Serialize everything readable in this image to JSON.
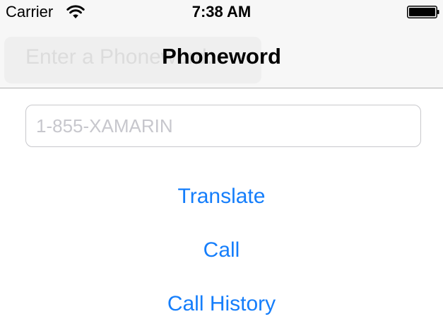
{
  "status_bar": {
    "carrier": "Carrier",
    "time": "7:38 AM",
    "icons": [
      "wifi-icon",
      "battery-icon"
    ]
  },
  "nav_bar": {
    "title": "Phoneword",
    "ghost_text": "Enter a Phoneword:"
  },
  "form": {
    "phone_placeholder": "1-855-XAMARIN",
    "phone_value": ""
  },
  "buttons": {
    "translate": "Translate",
    "call": "Call",
    "call_history": "Call History"
  },
  "colors": {
    "accent": "#157efb",
    "bar_background": "#f7f7f7",
    "placeholder": "#c7c7cd"
  }
}
